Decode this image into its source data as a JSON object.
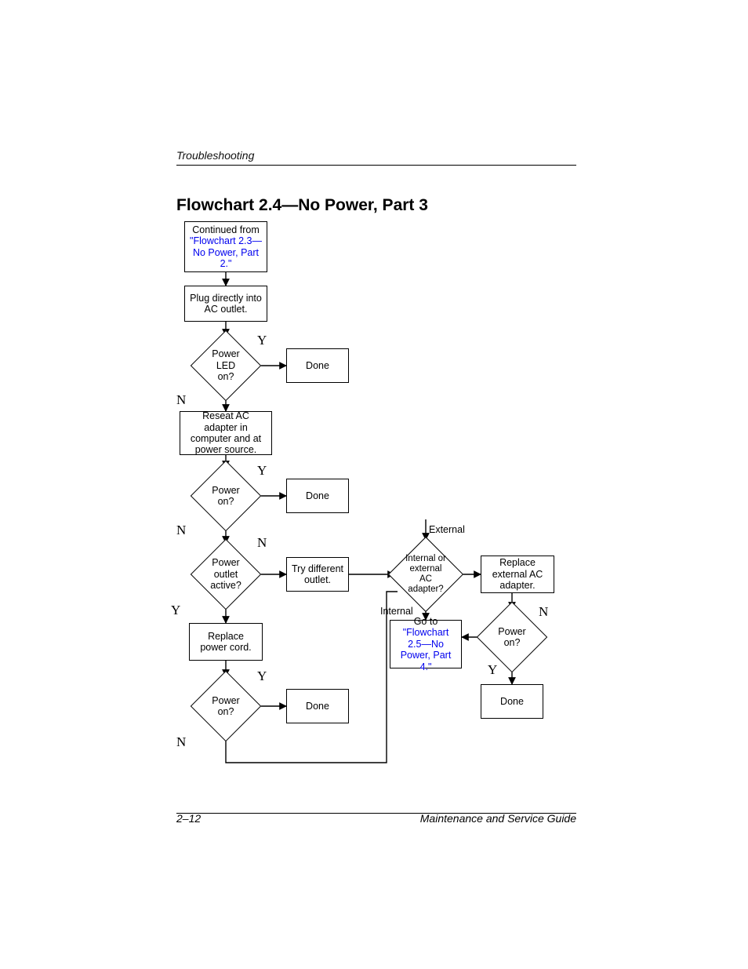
{
  "header": {
    "section": "Troubleshooting"
  },
  "title": "Flowchart 2.4—No Power, Part 3",
  "footer": {
    "page": "2–12",
    "guide": "Maintenance and Service Guide"
  },
  "nodes": {
    "start": {
      "line1": "Continued from",
      "link": "\"Flowchart 2.3—No Power, Part 2.\""
    },
    "plug": "Plug directly into AC outlet.",
    "led": "Power LED on?",
    "done1": "Done",
    "reseat": "Reseat AC adapter in computer and at power source.",
    "poweron1": "Power on?",
    "done2": "Done",
    "outlet": "Power outlet active?",
    "tryoutlet": "Try different outlet.",
    "replacecord": "Replace power cord.",
    "poweron2": "Power on?",
    "done3": "Done",
    "intext": "Internal or external AC adapter?",
    "replaceext": "Replace external AC adapter.",
    "goto": {
      "line1": "Go to",
      "link": "\"Flowchart 2.5—No Power, Part 4.\""
    },
    "poweron3": "Power on?",
    "done4": "Done"
  },
  "labels": {
    "Y": "Y",
    "N": "N",
    "External": "External",
    "Internal": "Internal"
  }
}
